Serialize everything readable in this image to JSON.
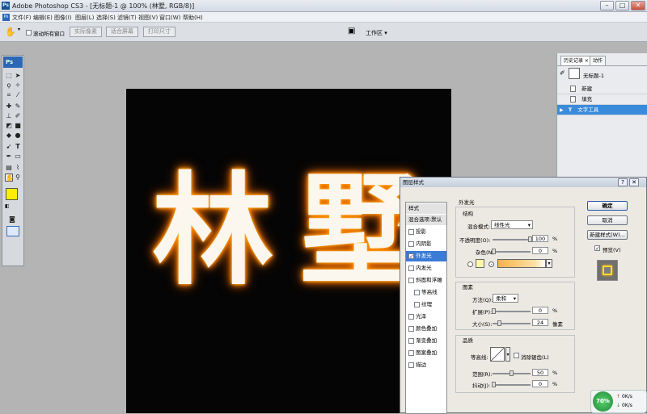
{
  "window": {
    "title": "Adobe Photoshop CS3 - [无标题-1 @ 100% (林墅, RGB/8)]",
    "controls": [
      "–",
      "□",
      "✕"
    ]
  },
  "menubar": [
    "文件(F)",
    "编辑(E)",
    "图像(I)",
    "图层(L)",
    "选择(S)",
    "滤镜(T)",
    "视图(V)",
    "窗口(W)",
    "帮助(H)"
  ],
  "options": {
    "scroll_all": "滚动所有窗口",
    "actual_pixels": "实际像素",
    "fit_screen": "适合屏幕",
    "print_size": "打印尺寸",
    "workspace": "工作区 ▾"
  },
  "toolbox": {
    "logo": "Ps"
  },
  "canvas": {
    "char1": "林",
    "char2": "墅"
  },
  "history": {
    "tabs": [
      "历史记录 ×",
      "动作"
    ],
    "snapshot": "无标题-1",
    "items": [
      "新建",
      "填充",
      "文字工具"
    ]
  },
  "dialog": {
    "title": "图层样式",
    "styles_header": "样式",
    "blend_options": "混合选项:默认",
    "effects": [
      "投影",
      "内阴影",
      "外发光",
      "内发光",
      "斜面和浮雕",
      "等高线",
      "纹理",
      "光泽",
      "颜色叠加",
      "渐变叠加",
      "图案叠加",
      "描边"
    ],
    "outer_glow": {
      "section": "外发光",
      "structure": "结构",
      "blend_mode_label": "混合模式:",
      "blend_mode": "线性光",
      "opacity_label": "不透明度(O):",
      "opacity": "100",
      "noise_label": "杂色(N):",
      "noise": "0",
      "percent": "%",
      "elements": "图素",
      "method_label": "方法(Q):",
      "method": "柔和",
      "spread_label": "扩展(P):",
      "spread": "0",
      "size_label": "大小(S):",
      "size": "24",
      "px": "像素",
      "quality": "品质",
      "contour_label": "等高线:",
      "anti_alias": "消除锯齿(L)",
      "range_label": "范围(R):",
      "range": "50",
      "jitter_label": "抖动(J):",
      "jitter": "0"
    },
    "buttons": {
      "ok": "确定",
      "cancel": "取消",
      "new_style": "新建样式(W)...",
      "preview": "预览(V)"
    }
  },
  "net_widget": {
    "percent": "70%",
    "up": "0K/s",
    "down": "0K/s"
  }
}
